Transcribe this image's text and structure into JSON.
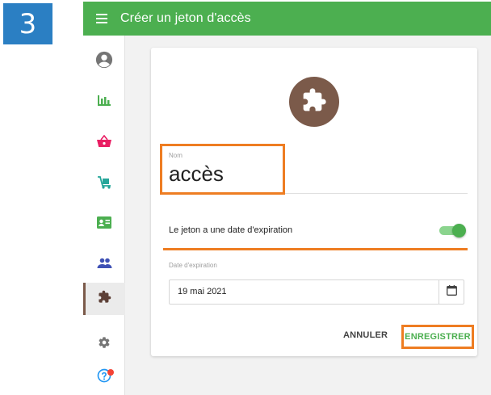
{
  "step_number": "3",
  "header": {
    "title": "Créer un jeton d'accès",
    "menu_icon": "hamburger-menu-icon"
  },
  "sidebar": {
    "items": [
      {
        "icon": "account-circle-icon",
        "color": "#757575"
      },
      {
        "icon": "bar-chart-icon",
        "color": "#4caf50"
      },
      {
        "icon": "shopping-basket-icon",
        "color": "#e91e63"
      },
      {
        "icon": "dolly-cart-icon",
        "color": "#26a69a"
      },
      {
        "icon": "contact-card-icon",
        "color": "#4caf50"
      },
      {
        "icon": "group-icon",
        "color": "#3f51b5"
      },
      {
        "icon": "puzzle-piece-icon",
        "color": "#7b5a4a",
        "active": true
      },
      {
        "icon": "gear-icon",
        "color": "#757575"
      },
      {
        "icon": "help-icon",
        "color": "#2196f3",
        "notification": true
      }
    ]
  },
  "form": {
    "avatar_icon": "puzzle-piece-icon",
    "name_label": "Nom",
    "name_value": "accès",
    "expiry_toggle_label": "Le jeton a une date d'expiration",
    "expiry_toggle_on": true,
    "expiry_date_label": "Date d'expiration",
    "expiry_date_value": "19 mai 2021",
    "calendar_icon": "calendar-icon"
  },
  "actions": {
    "cancel_label": "ANNULER",
    "save_label": "ENREGISTRER"
  },
  "colors": {
    "primary": "#4caf50",
    "accent_brown": "#7b5a4a",
    "highlight_orange": "#ee7d22",
    "step_badge": "#2b7fc3"
  }
}
